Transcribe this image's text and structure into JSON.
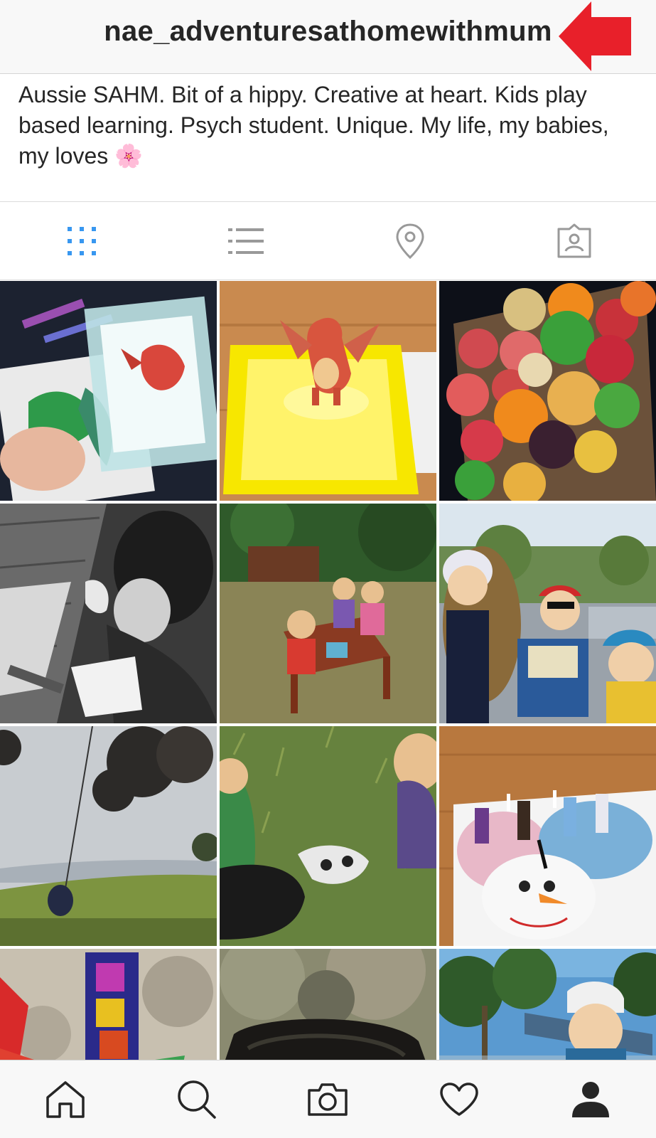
{
  "header": {
    "username": "nae_adventuresathomewithmum"
  },
  "bio": {
    "text": "Aussie SAHM. Bit of a hippy. Creative at heart. Kids play based learning. Psych student. Unique. My life, my babies, my loves 🌸"
  },
  "tabs": [
    {
      "name": "grid",
      "icon": "grid-icon",
      "active": true
    },
    {
      "name": "list",
      "icon": "list-icon",
      "active": false
    },
    {
      "name": "places",
      "icon": "location-pin-icon",
      "active": false
    },
    {
      "name": "tagged",
      "icon": "tagged-person-icon",
      "active": false
    }
  ],
  "posts": [
    {
      "subject": "child coloring dragon page with AR dragon"
    },
    {
      "subject": "AR dragon on glowing yellow card"
    },
    {
      "subject": "basket of apples and oranges"
    },
    {
      "subject": "black and white child writing"
    },
    {
      "subject": "kids at picnic table outdoors"
    },
    {
      "subject": "kids with Where's Wally book"
    },
    {
      "subject": "child on rope swing in foggy field"
    },
    {
      "subject": "kids looking at animal skull in grass"
    },
    {
      "subject": "Frozen themed birthday cake"
    },
    {
      "subject": "colorful magnetic tiles on stone"
    },
    {
      "subject": "rocky cave entrance"
    },
    {
      "subject": "child in helmet at ropes course"
    }
  ],
  "bottom_nav": [
    {
      "name": "home",
      "icon": "home-icon",
      "active": false
    },
    {
      "name": "search",
      "icon": "search-icon",
      "active": false
    },
    {
      "name": "camera",
      "icon": "camera-icon",
      "active": false
    },
    {
      "name": "activity",
      "icon": "heart-icon",
      "active": false
    },
    {
      "name": "profile",
      "icon": "profile-icon",
      "active": true
    }
  ],
  "colors": {
    "accent": "#3897f0",
    "annotation_arrow": "#e8202a",
    "icon_gray": "#999999",
    "text": "#262626"
  }
}
